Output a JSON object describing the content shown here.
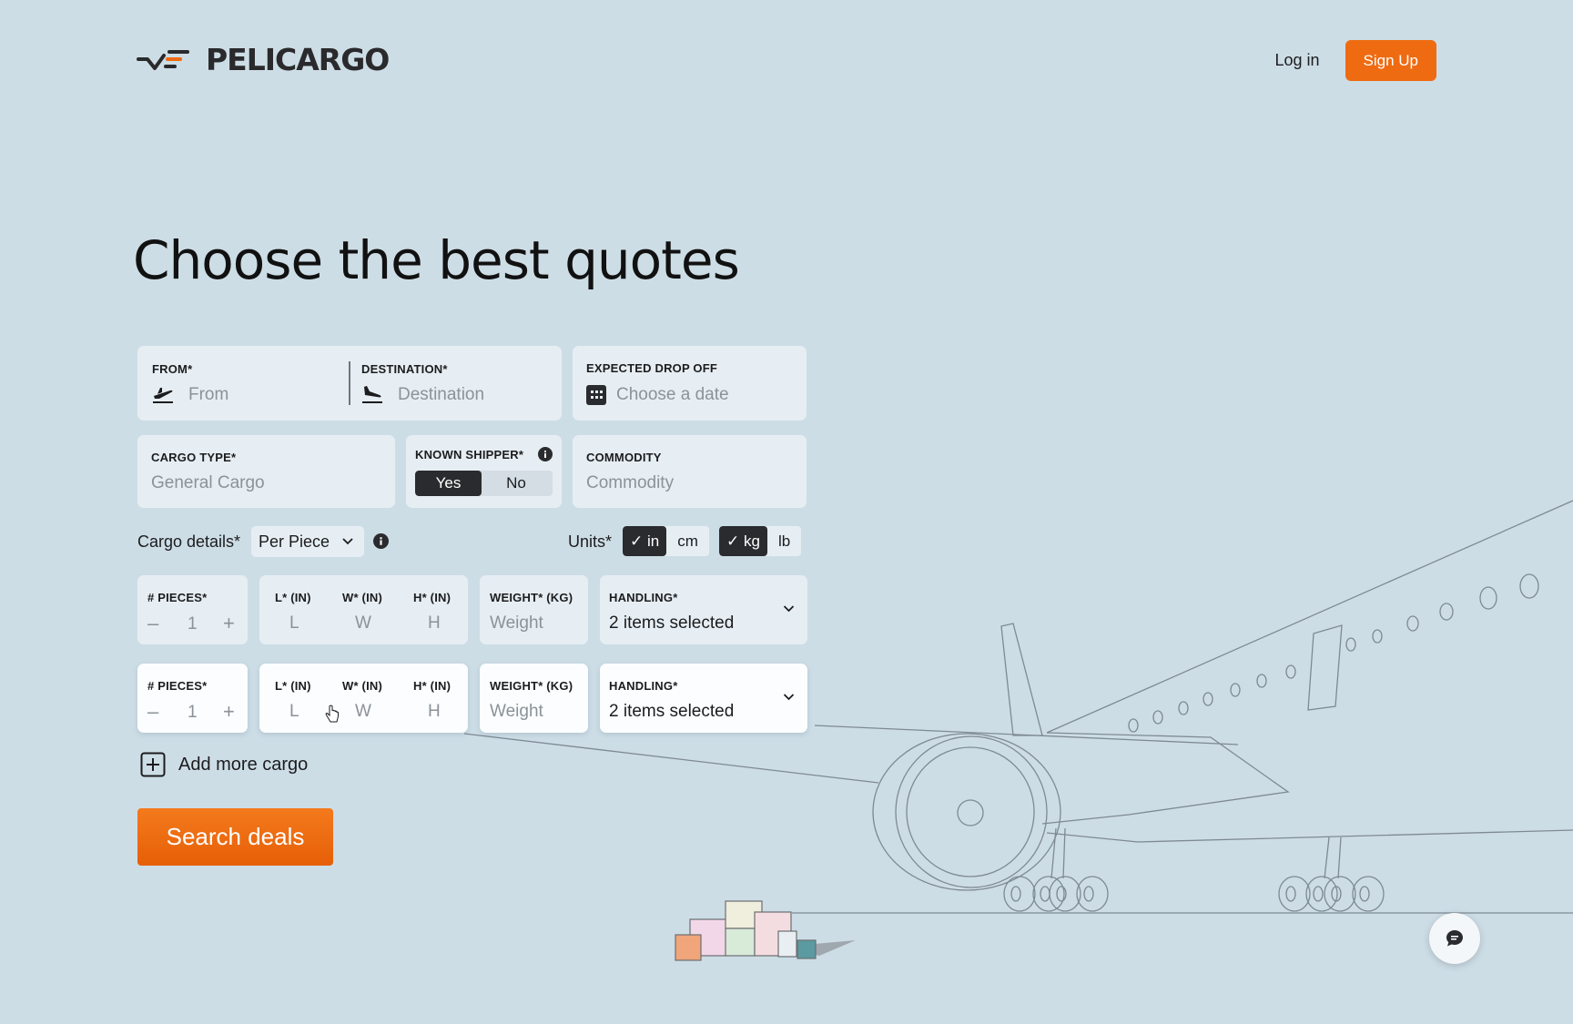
{
  "brand": {
    "name": "PELICARGO"
  },
  "nav": {
    "login": "Log in",
    "signup": "Sign Up"
  },
  "hero": {
    "title": "Choose the best quotes"
  },
  "form": {
    "from": {
      "label": "FROM*",
      "placeholder": "From"
    },
    "destination": {
      "label": "DESTINATION*",
      "placeholder": "Destination"
    },
    "drop_off": {
      "label": "EXPECTED DROP OFF",
      "placeholder": "Choose a date"
    },
    "cargo_type": {
      "label": "CARGO TYPE*",
      "placeholder": "General Cargo"
    },
    "known_shipper": {
      "label": "KNOWN SHIPPER*",
      "options": [
        "Yes",
        "No"
      ],
      "selected": "Yes"
    },
    "commodity": {
      "label": "COMMODITY",
      "placeholder": "Commodity"
    },
    "cargo_details": {
      "label": "Cargo details*",
      "mode": "Per Piece"
    },
    "units": {
      "label": "Units*",
      "length": [
        "in",
        "cm"
      ],
      "length_selected": "in",
      "weight": [
        "kg",
        "lb"
      ],
      "weight_selected": "kg"
    },
    "rows": [
      {
        "pieces_label": "# PIECES*",
        "pieces": "1",
        "l_label": "L* (IN)",
        "l_ph": "L",
        "w_label": "W* (IN)",
        "w_ph": "W",
        "h_label": "H* (IN)",
        "h_ph": "H",
        "weight_label": "WEIGHT* (KG)",
        "weight_ph": "Weight",
        "handling_label": "HANDLING*",
        "handling_value": "2 items selected"
      },
      {
        "pieces_label": "# PIECES*",
        "pieces": "1",
        "l_label": "L* (IN)",
        "l_ph": "L",
        "w_label": "W* (IN)",
        "w_ph": "W",
        "h_label": "H* (IN)",
        "h_ph": "H",
        "weight_label": "WEIGHT* (KG)",
        "weight_ph": "Weight",
        "handling_label": "HANDLING*",
        "handling_value": "2 items selected"
      }
    ],
    "add_more": "Add more cargo",
    "search": "Search deals"
  },
  "colors": {
    "accent": "#ef6b11",
    "background": "#cddde6",
    "field": "#e6eef3",
    "dark": "#2a2b2e"
  }
}
